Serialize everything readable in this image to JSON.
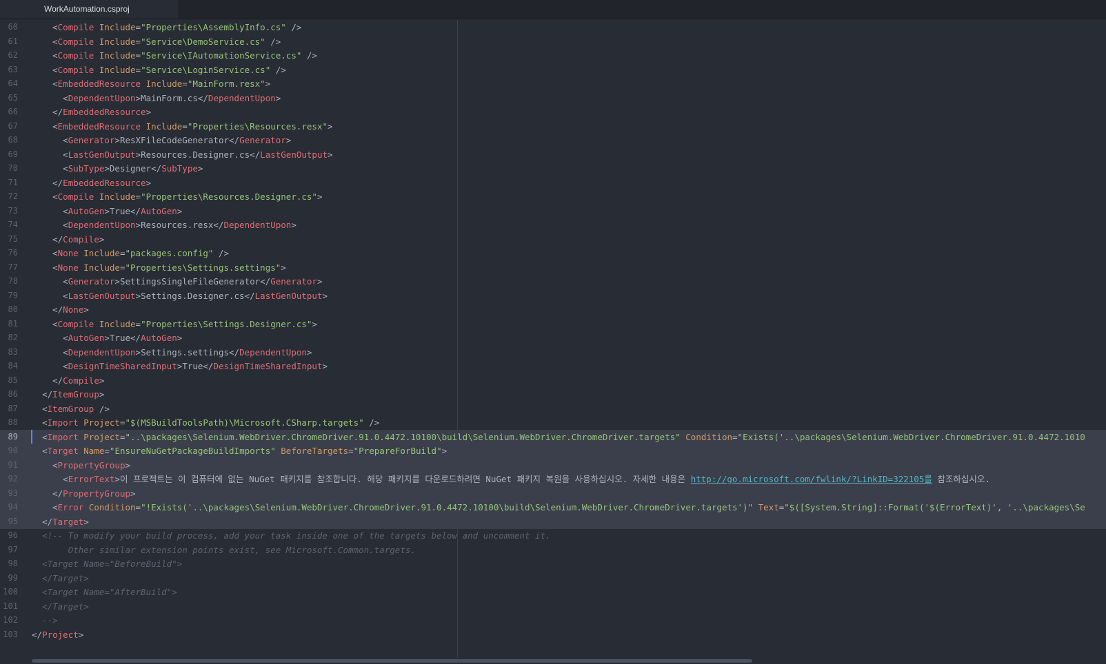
{
  "tab": {
    "title": "WorkAutomation.csproj"
  },
  "active_line": 89,
  "selected_lines": [
    89,
    90,
    91,
    92,
    93,
    94,
    95
  ],
  "lines": [
    {
      "n": "60",
      "tokens": [
        [
          "t",
          "    "
        ],
        [
          "p",
          "<"
        ],
        [
          "g",
          "Compile"
        ],
        [
          "p",
          " "
        ],
        [
          "a",
          "Include"
        ],
        [
          "p",
          "="
        ],
        [
          "s",
          "\"Properties\\AssemblyInfo.cs\""
        ],
        [
          "p",
          " />"
        ]
      ]
    },
    {
      "n": "61",
      "tokens": [
        [
          "t",
          "    "
        ],
        [
          "p",
          "<"
        ],
        [
          "g",
          "Compile"
        ],
        [
          "p",
          " "
        ],
        [
          "a",
          "Include"
        ],
        [
          "p",
          "="
        ],
        [
          "s",
          "\"Service\\DemoService.cs\""
        ],
        [
          "p",
          " />"
        ]
      ]
    },
    {
      "n": "62",
      "tokens": [
        [
          "t",
          "    "
        ],
        [
          "p",
          "<"
        ],
        [
          "g",
          "Compile"
        ],
        [
          "p",
          " "
        ],
        [
          "a",
          "Include"
        ],
        [
          "p",
          "="
        ],
        [
          "s",
          "\"Service\\IAutomationService.cs\""
        ],
        [
          "p",
          " />"
        ]
      ]
    },
    {
      "n": "63",
      "tokens": [
        [
          "t",
          "    "
        ],
        [
          "p",
          "<"
        ],
        [
          "g",
          "Compile"
        ],
        [
          "p",
          " "
        ],
        [
          "a",
          "Include"
        ],
        [
          "p",
          "="
        ],
        [
          "s",
          "\"Service\\LoginService.cs\""
        ],
        [
          "p",
          " />"
        ]
      ]
    },
    {
      "n": "64",
      "tokens": [
        [
          "t",
          "    "
        ],
        [
          "p",
          "<"
        ],
        [
          "g",
          "EmbeddedResource"
        ],
        [
          "p",
          " "
        ],
        [
          "a",
          "Include"
        ],
        [
          "p",
          "="
        ],
        [
          "s",
          "\"MainForm.resx\""
        ],
        [
          "p",
          ">"
        ]
      ]
    },
    {
      "n": "65",
      "tokens": [
        [
          "t",
          "      "
        ],
        [
          "p",
          "<"
        ],
        [
          "g",
          "DependentUpon"
        ],
        [
          "p",
          ">"
        ],
        [
          "t",
          "MainForm.cs"
        ],
        [
          "p",
          "</"
        ],
        [
          "g",
          "DependentUpon"
        ],
        [
          "p",
          ">"
        ]
      ]
    },
    {
      "n": "66",
      "tokens": [
        [
          "t",
          "    "
        ],
        [
          "p",
          "</"
        ],
        [
          "g",
          "EmbeddedResource"
        ],
        [
          "p",
          ">"
        ]
      ]
    },
    {
      "n": "67",
      "tokens": [
        [
          "t",
          "    "
        ],
        [
          "p",
          "<"
        ],
        [
          "g",
          "EmbeddedResource"
        ],
        [
          "p",
          " "
        ],
        [
          "a",
          "Include"
        ],
        [
          "p",
          "="
        ],
        [
          "s",
          "\"Properties\\Resources.resx\""
        ],
        [
          "p",
          ">"
        ]
      ]
    },
    {
      "n": "68",
      "tokens": [
        [
          "t",
          "      "
        ],
        [
          "p",
          "<"
        ],
        [
          "g",
          "Generator"
        ],
        [
          "p",
          ">"
        ],
        [
          "t",
          "ResXFileCodeGenerator"
        ],
        [
          "p",
          "</"
        ],
        [
          "g",
          "Generator"
        ],
        [
          "p",
          ">"
        ]
      ]
    },
    {
      "n": "69",
      "tokens": [
        [
          "t",
          "      "
        ],
        [
          "p",
          "<"
        ],
        [
          "g",
          "LastGenOutput"
        ],
        [
          "p",
          ">"
        ],
        [
          "t",
          "Resources.Designer.cs"
        ],
        [
          "p",
          "</"
        ],
        [
          "g",
          "LastGenOutput"
        ],
        [
          "p",
          ">"
        ]
      ]
    },
    {
      "n": "70",
      "tokens": [
        [
          "t",
          "      "
        ],
        [
          "p",
          "<"
        ],
        [
          "g",
          "SubType"
        ],
        [
          "p",
          ">"
        ],
        [
          "t",
          "Designer"
        ],
        [
          "p",
          "</"
        ],
        [
          "g",
          "SubType"
        ],
        [
          "p",
          ">"
        ]
      ]
    },
    {
      "n": "71",
      "tokens": [
        [
          "t",
          "    "
        ],
        [
          "p",
          "</"
        ],
        [
          "g",
          "EmbeddedResource"
        ],
        [
          "p",
          ">"
        ]
      ]
    },
    {
      "n": "72",
      "tokens": [
        [
          "t",
          "    "
        ],
        [
          "p",
          "<"
        ],
        [
          "g",
          "Compile"
        ],
        [
          "p",
          " "
        ],
        [
          "a",
          "Include"
        ],
        [
          "p",
          "="
        ],
        [
          "s",
          "\"Properties\\Resources.Designer.cs\""
        ],
        [
          "p",
          ">"
        ]
      ]
    },
    {
      "n": "73",
      "tokens": [
        [
          "t",
          "      "
        ],
        [
          "p",
          "<"
        ],
        [
          "g",
          "AutoGen"
        ],
        [
          "p",
          ">"
        ],
        [
          "t",
          "True"
        ],
        [
          "p",
          "</"
        ],
        [
          "g",
          "AutoGen"
        ],
        [
          "p",
          ">"
        ]
      ]
    },
    {
      "n": "74",
      "tokens": [
        [
          "t",
          "      "
        ],
        [
          "p",
          "<"
        ],
        [
          "g",
          "DependentUpon"
        ],
        [
          "p",
          ">"
        ],
        [
          "t",
          "Resources.resx"
        ],
        [
          "p",
          "</"
        ],
        [
          "g",
          "DependentUpon"
        ],
        [
          "p",
          ">"
        ]
      ]
    },
    {
      "n": "75",
      "tokens": [
        [
          "t",
          "    "
        ],
        [
          "p",
          "</"
        ],
        [
          "g",
          "Compile"
        ],
        [
          "p",
          ">"
        ]
      ]
    },
    {
      "n": "76",
      "tokens": [
        [
          "t",
          "    "
        ],
        [
          "p",
          "<"
        ],
        [
          "g",
          "None"
        ],
        [
          "p",
          " "
        ],
        [
          "a",
          "Include"
        ],
        [
          "p",
          "="
        ],
        [
          "s",
          "\"packages.config\""
        ],
        [
          "p",
          " />"
        ]
      ]
    },
    {
      "n": "77",
      "tokens": [
        [
          "t",
          "    "
        ],
        [
          "p",
          "<"
        ],
        [
          "g",
          "None"
        ],
        [
          "p",
          " "
        ],
        [
          "a",
          "Include"
        ],
        [
          "p",
          "="
        ],
        [
          "s",
          "\"Properties\\Settings.settings\""
        ],
        [
          "p",
          ">"
        ]
      ]
    },
    {
      "n": "78",
      "tokens": [
        [
          "t",
          "      "
        ],
        [
          "p",
          "<"
        ],
        [
          "g",
          "Generator"
        ],
        [
          "p",
          ">"
        ],
        [
          "t",
          "SettingsSingleFileGenerator"
        ],
        [
          "p",
          "</"
        ],
        [
          "g",
          "Generator"
        ],
        [
          "p",
          ">"
        ]
      ]
    },
    {
      "n": "79",
      "tokens": [
        [
          "t",
          "      "
        ],
        [
          "p",
          "<"
        ],
        [
          "g",
          "LastGenOutput"
        ],
        [
          "p",
          ">"
        ],
        [
          "t",
          "Settings.Designer.cs"
        ],
        [
          "p",
          "</"
        ],
        [
          "g",
          "LastGenOutput"
        ],
        [
          "p",
          ">"
        ]
      ]
    },
    {
      "n": "80",
      "tokens": [
        [
          "t",
          "    "
        ],
        [
          "p",
          "</"
        ],
        [
          "g",
          "None"
        ],
        [
          "p",
          ">"
        ]
      ]
    },
    {
      "n": "81",
      "tokens": [
        [
          "t",
          "    "
        ],
        [
          "p",
          "<"
        ],
        [
          "g",
          "Compile"
        ],
        [
          "p",
          " "
        ],
        [
          "a",
          "Include"
        ],
        [
          "p",
          "="
        ],
        [
          "s",
          "\"Properties\\Settings.Designer.cs\""
        ],
        [
          "p",
          ">"
        ]
      ]
    },
    {
      "n": "82",
      "tokens": [
        [
          "t",
          "      "
        ],
        [
          "p",
          "<"
        ],
        [
          "g",
          "AutoGen"
        ],
        [
          "p",
          ">"
        ],
        [
          "t",
          "True"
        ],
        [
          "p",
          "</"
        ],
        [
          "g",
          "AutoGen"
        ],
        [
          "p",
          ">"
        ]
      ]
    },
    {
      "n": "83",
      "tokens": [
        [
          "t",
          "      "
        ],
        [
          "p",
          "<"
        ],
        [
          "g",
          "DependentUpon"
        ],
        [
          "p",
          ">"
        ],
        [
          "t",
          "Settings.settings"
        ],
        [
          "p",
          "</"
        ],
        [
          "g",
          "DependentUpon"
        ],
        [
          "p",
          ">"
        ]
      ]
    },
    {
      "n": "84",
      "tokens": [
        [
          "t",
          "      "
        ],
        [
          "p",
          "<"
        ],
        [
          "g",
          "DesignTimeSharedInput"
        ],
        [
          "p",
          ">"
        ],
        [
          "t",
          "True"
        ],
        [
          "p",
          "</"
        ],
        [
          "g",
          "DesignTimeSharedInput"
        ],
        [
          "p",
          ">"
        ]
      ]
    },
    {
      "n": "85",
      "tokens": [
        [
          "t",
          "    "
        ],
        [
          "p",
          "</"
        ],
        [
          "g",
          "Compile"
        ],
        [
          "p",
          ">"
        ]
      ]
    },
    {
      "n": "86",
      "tokens": [
        [
          "t",
          "  "
        ],
        [
          "p",
          "</"
        ],
        [
          "g",
          "ItemGroup"
        ],
        [
          "p",
          ">"
        ]
      ]
    },
    {
      "n": "87",
      "tokens": [
        [
          "t",
          "  "
        ],
        [
          "p",
          "<"
        ],
        [
          "g",
          "ItemGroup"
        ],
        [
          "p",
          " />"
        ]
      ]
    },
    {
      "n": "88",
      "tokens": [
        [
          "t",
          "  "
        ],
        [
          "p",
          "<"
        ],
        [
          "g",
          "Import"
        ],
        [
          "p",
          " "
        ],
        [
          "a",
          "Project"
        ],
        [
          "p",
          "="
        ],
        [
          "s",
          "\"$(MSBuildToolsPath)\\Microsoft.CSharp.targets\""
        ],
        [
          "p",
          " />"
        ]
      ]
    },
    {
      "n": "89",
      "tokens": [
        [
          "t",
          "  "
        ],
        [
          "p",
          "<"
        ],
        [
          "g",
          "Import"
        ],
        [
          "p",
          " "
        ],
        [
          "a",
          "Project"
        ],
        [
          "p",
          "="
        ],
        [
          "s",
          "\"..\\packages\\Selenium.WebDriver.ChromeDriver.91.0.4472.10100\\build\\Selenium.WebDriver.ChromeDriver.targets\""
        ],
        [
          "p",
          " "
        ],
        [
          "a",
          "Condition"
        ],
        [
          "p",
          "="
        ],
        [
          "s",
          "\"Exists('..\\packages\\Selenium.WebDriver.ChromeDriver.91.0.4472.1010"
        ]
      ]
    },
    {
      "n": "90",
      "tokens": [
        [
          "t",
          "  "
        ],
        [
          "p",
          "<"
        ],
        [
          "g",
          "Target"
        ],
        [
          "p",
          " "
        ],
        [
          "a",
          "Name"
        ],
        [
          "p",
          "="
        ],
        [
          "s",
          "\"EnsureNuGetPackageBuildImports\""
        ],
        [
          "p",
          " "
        ],
        [
          "a",
          "BeforeTargets"
        ],
        [
          "p",
          "="
        ],
        [
          "s",
          "\"PrepareForBuild\""
        ],
        [
          "p",
          ">"
        ]
      ]
    },
    {
      "n": "91",
      "tokens": [
        [
          "t",
          "    "
        ],
        [
          "p",
          "<"
        ],
        [
          "g",
          "PropertyGroup"
        ],
        [
          "p",
          ">"
        ]
      ]
    },
    {
      "n": "92",
      "tokens": [
        [
          "t",
          "      "
        ],
        [
          "p",
          "<"
        ],
        [
          "g",
          "ErrorText"
        ],
        [
          "p",
          ">"
        ],
        [
          "t",
          "이 프로젝트는 이 컴퓨터에 없는 NuGet 패키지를 참조합니다. 해당 패키지를 다운로드하려면 NuGet 패키지 복원을 사용하십시오. 자세한 내용은 "
        ],
        [
          "l",
          "http://go.microsoft.com/fwlink/?LinkID=322105를"
        ],
        [
          "t",
          " 참조하십시오."
        ]
      ]
    },
    {
      "n": "93",
      "tokens": [
        [
          "t",
          "    "
        ],
        [
          "p",
          "</"
        ],
        [
          "g",
          "PropertyGroup"
        ],
        [
          "p",
          ">"
        ]
      ]
    },
    {
      "n": "94",
      "tokens": [
        [
          "t",
          "    "
        ],
        [
          "p",
          "<"
        ],
        [
          "g",
          "Error"
        ],
        [
          "p",
          " "
        ],
        [
          "a",
          "Condition"
        ],
        [
          "p",
          "="
        ],
        [
          "s",
          "\"!Exists('..\\packages\\Selenium.WebDriver.ChromeDriver.91.0.4472.10100\\build\\Selenium.WebDriver.ChromeDriver.targets')\""
        ],
        [
          "p",
          " "
        ],
        [
          "a",
          "Text"
        ],
        [
          "p",
          "="
        ],
        [
          "s",
          "\"$([System.String]::Format('$(ErrorText)', '..\\packages\\Se"
        ]
      ]
    },
    {
      "n": "95",
      "tokens": [
        [
          "t",
          "  "
        ],
        [
          "p",
          "</"
        ],
        [
          "g",
          "Target"
        ],
        [
          "p",
          ">"
        ]
      ]
    },
    {
      "n": "96",
      "tokens": [
        [
          "c",
          "  <!-- To modify your build process, add your task inside one of the targets below and uncomment it."
        ]
      ]
    },
    {
      "n": "97",
      "tokens": [
        [
          "c",
          "       Other similar extension points exist, see Microsoft.Common.targets."
        ]
      ]
    },
    {
      "n": "98",
      "tokens": [
        [
          "c",
          "  <Target Name=\"BeforeBuild\">"
        ]
      ]
    },
    {
      "n": "99",
      "tokens": [
        [
          "c",
          "  </Target>"
        ]
      ]
    },
    {
      "n": "100",
      "tokens": [
        [
          "c",
          "  <Target Name=\"AfterBuild\">"
        ]
      ]
    },
    {
      "n": "101",
      "tokens": [
        [
          "c",
          "  </Target>"
        ]
      ]
    },
    {
      "n": "102",
      "tokens": [
        [
          "c",
          "  -->"
        ]
      ]
    },
    {
      "n": "103",
      "tokens": [
        [
          "p",
          "</"
        ],
        [
          "g",
          "Project"
        ],
        [
          "p",
          ">"
        ]
      ]
    }
  ]
}
